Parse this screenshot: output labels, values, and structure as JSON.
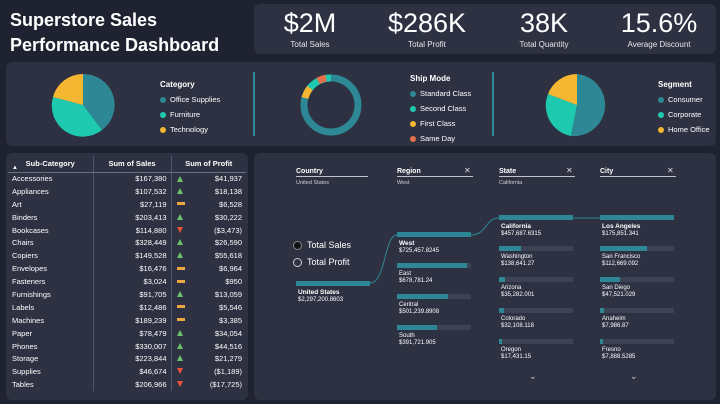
{
  "title": "Superstore Sales Performance Dashboard",
  "kpis": [
    {
      "value": "$2M",
      "label": "Total Sales"
    },
    {
      "value": "$286K",
      "label": "Total Profit"
    },
    {
      "value": "38K",
      "label": "Total Quantity"
    },
    {
      "value": "15.6%",
      "label": "Average Discount"
    }
  ],
  "colors": {
    "teal": "#2d8795",
    "aqua": "#1fc9b0",
    "yellow": "#f5b731",
    "orange": "#e5714a",
    "red": "#e8533a",
    "green": "#6cc36e"
  },
  "category": {
    "title": "Category",
    "items": [
      "Office Supplies",
      "Furniture",
      "Technology"
    ]
  },
  "shipmode": {
    "title": "Ship Mode",
    "items": [
      "Standard Class",
      "Second Class",
      "First Class",
      "Same Day"
    ]
  },
  "segment": {
    "title": "Segment",
    "items": [
      "Consumer",
      "Corporate",
      "Home Office"
    ]
  },
  "table": {
    "headers": [
      "Sub-Category",
      "Sum of Sales",
      "Sum of Profit"
    ],
    "rows": [
      {
        "name": "Accessories",
        "sales": "$167,380",
        "profit": "$41,937",
        "ind": "up"
      },
      {
        "name": "Appliances",
        "sales": "$107,532",
        "profit": "$18,138",
        "ind": "up"
      },
      {
        "name": "Art",
        "sales": "$27,119",
        "profit": "$6,528",
        "ind": "flat"
      },
      {
        "name": "Binders",
        "sales": "$203,413",
        "profit": "$30,222",
        "ind": "up"
      },
      {
        "name": "Bookcases",
        "sales": "$114,880",
        "profit": "($3,473)",
        "ind": "down"
      },
      {
        "name": "Chairs",
        "sales": "$328,449",
        "profit": "$26,590",
        "ind": "up"
      },
      {
        "name": "Copiers",
        "sales": "$149,528",
        "profit": "$55,618",
        "ind": "up"
      },
      {
        "name": "Envelopes",
        "sales": "$16,476",
        "profit": "$6,964",
        "ind": "flat"
      },
      {
        "name": "Fasteners",
        "sales": "$3,024",
        "profit": "$950",
        "ind": "flat"
      },
      {
        "name": "Furnishings",
        "sales": "$91,705",
        "profit": "$13,059",
        "ind": "up"
      },
      {
        "name": "Labels",
        "sales": "$12,486",
        "profit": "$5,546",
        "ind": "flat"
      },
      {
        "name": "Machines",
        "sales": "$189,239",
        "profit": "$3,385",
        "ind": "flat"
      },
      {
        "name": "Paper",
        "sales": "$78,479",
        "profit": "$34,054",
        "ind": "up"
      },
      {
        "name": "Phones",
        "sales": "$330,007",
        "profit": "$44,516",
        "ind": "up"
      },
      {
        "name": "Storage",
        "sales": "$223,844",
        "profit": "$21,279",
        "ind": "up"
      },
      {
        "name": "Supplies",
        "sales": "$46,674",
        "profit": "($1,189)",
        "ind": "down"
      },
      {
        "name": "Tables",
        "sales": "$206,966",
        "profit": "($17,725)",
        "ind": "down"
      }
    ]
  },
  "decomp": {
    "radio": [
      "Total Sales",
      "Total Profit"
    ],
    "cols": [
      {
        "head": "Country",
        "sub": "United States"
      },
      {
        "head": "Region",
        "sub": "West"
      },
      {
        "head": "State",
        "sub": "California"
      },
      {
        "head": "City",
        "sub": ""
      }
    ],
    "root": {
      "name": "United States",
      "value": "$2,297,200.8603"
    },
    "regions": [
      {
        "name": "West",
        "value": "$725,457.8245",
        "frac": 1.0
      },
      {
        "name": "East",
        "value": "$678,781.24",
        "frac": 0.94
      },
      {
        "name": "Central",
        "value": "$501,239.8908",
        "frac": 0.69
      },
      {
        "name": "South",
        "value": "$391,721.905",
        "frac": 0.54
      }
    ],
    "states": [
      {
        "name": "California",
        "value": "$457,687.6315",
        "frac": 1.0
      },
      {
        "name": "Washington",
        "value": "$138,641.27",
        "frac": 0.3
      },
      {
        "name": "Arizona",
        "value": "$35,282.001",
        "frac": 0.08
      },
      {
        "name": "Colorado",
        "value": "$32,108.118",
        "frac": 0.07
      },
      {
        "name": "Oregon",
        "value": "$17,431.15",
        "frac": 0.04
      }
    ],
    "cities": [
      {
        "name": "Los Angeles",
        "value": "$175,851.341",
        "frac": 1.0
      },
      {
        "name": "San Francisco",
        "value": "$112,669.092",
        "frac": 0.64
      },
      {
        "name": "San Diego",
        "value": "$47,521.029",
        "frac": 0.27
      },
      {
        "name": "Anaheim",
        "value": "$7,986.87",
        "frac": 0.05
      },
      {
        "name": "Fresno",
        "value": "$7,888.5285",
        "frac": 0.04
      }
    ]
  }
}
